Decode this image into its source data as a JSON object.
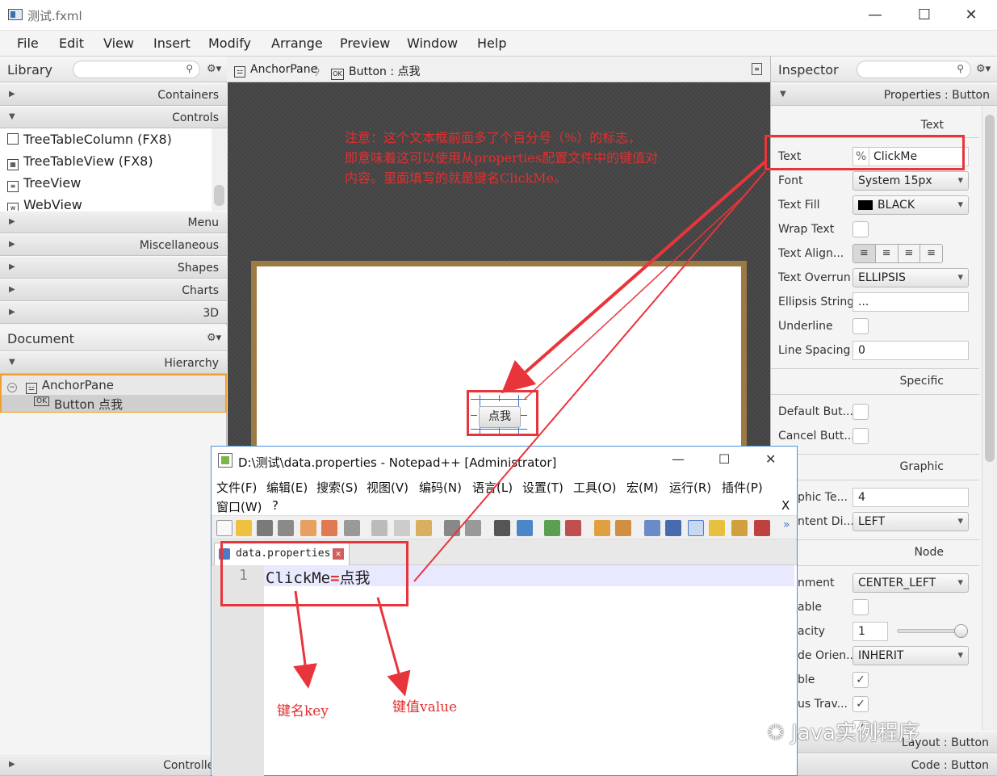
{
  "window": {
    "title": "测试.fxml",
    "minimize": "—",
    "maximize": "☐",
    "close": "✕"
  },
  "menubar": [
    "File",
    "Edit",
    "View",
    "Insert",
    "Modify",
    "Arrange",
    "Preview",
    "Window",
    "Help"
  ],
  "library": {
    "title": "Library",
    "sections_top": [
      "Containers",
      "Controls"
    ],
    "items": [
      "TreeTableColumn  (FX8)",
      "TreeTableView  (FX8)",
      "TreeView",
      "WebView"
    ],
    "sections_bottom": [
      "Menu",
      "Miscellaneous",
      "Shapes",
      "Charts",
      "3D"
    ]
  },
  "document": {
    "title": "Document",
    "hierarchy_label": "Hierarchy",
    "tree": [
      "AnchorPane",
      "Button  点我"
    ],
    "controller_label": "Controller"
  },
  "breadcrumb": {
    "root": "AnchorPane",
    "sep": "〉",
    "child": "Button : 点我"
  },
  "preview": {
    "button_text": "点我"
  },
  "annotation": {
    "lines": [
      "注意：这个文本框前面多了个百分号（%）的标志，",
      "即意味着这可以使用从properties配置文件中的键值对",
      "内容。里面填写的就是键名ClickMe。"
    ],
    "key_label": "键名key",
    "value_label": "键值value"
  },
  "inspector": {
    "title": "Inspector",
    "properties_header": "Properties : Button",
    "section_text": "Text",
    "text_label": "Text",
    "text_prefix": "%",
    "text_value": "ClickMe",
    "font_label": "Font",
    "font_value": "System 15px",
    "textfill_label": "Text Fill",
    "textfill_value": "BLACK",
    "wrap_label": "Wrap Text",
    "align_label": "Text Align...",
    "overrun_label": "Text Overrun",
    "overrun_value": "ELLIPSIS",
    "ellipsis_label": "Ellipsis String",
    "ellipsis_value": "...",
    "underline_label": "Underline",
    "spacing_label": "Line Spacing",
    "spacing_value": "0",
    "section_specific": "Specific",
    "default_label": "Default But...",
    "cancel_label": "Cancel Butt...",
    "section_graphic": "Graphic",
    "graphic_text_label": "phic Te...",
    "graphic_text_value": "4",
    "content_label": "ntent Di...",
    "content_value": "LEFT",
    "section_node": "Node",
    "alignment_label": "nment",
    "alignment_value": "CENTER_LEFT",
    "disable_label": "able",
    "opacity_label": "acity",
    "opacity_value": "1",
    "orient_label": "de Orien...",
    "orient_value": "INHERIT",
    "visible_label": "ble",
    "focus_label": "us Trav...",
    "layout_label": "Layout : Button",
    "code_label": "Code : Button"
  },
  "notepad": {
    "title": "D:\\测试\\data.properties - Notepad++ [Administrator]",
    "menu_row1": [
      "文件(F)",
      "编辑(E)",
      "搜索(S)",
      "视图(V)",
      "编码(N)",
      "语言(L)",
      "设置(T)",
      "工具(O)",
      "宏(M)",
      "运行(R)",
      "插件(P)"
    ],
    "menu_row2": [
      "窗口(W)",
      "?"
    ],
    "close_x": "X",
    "tab": "data.properties",
    "line_number": "1",
    "code_key": "ClickMe",
    "code_eq": "=",
    "code_value": "点我"
  },
  "watermark": "Java实例程序"
}
